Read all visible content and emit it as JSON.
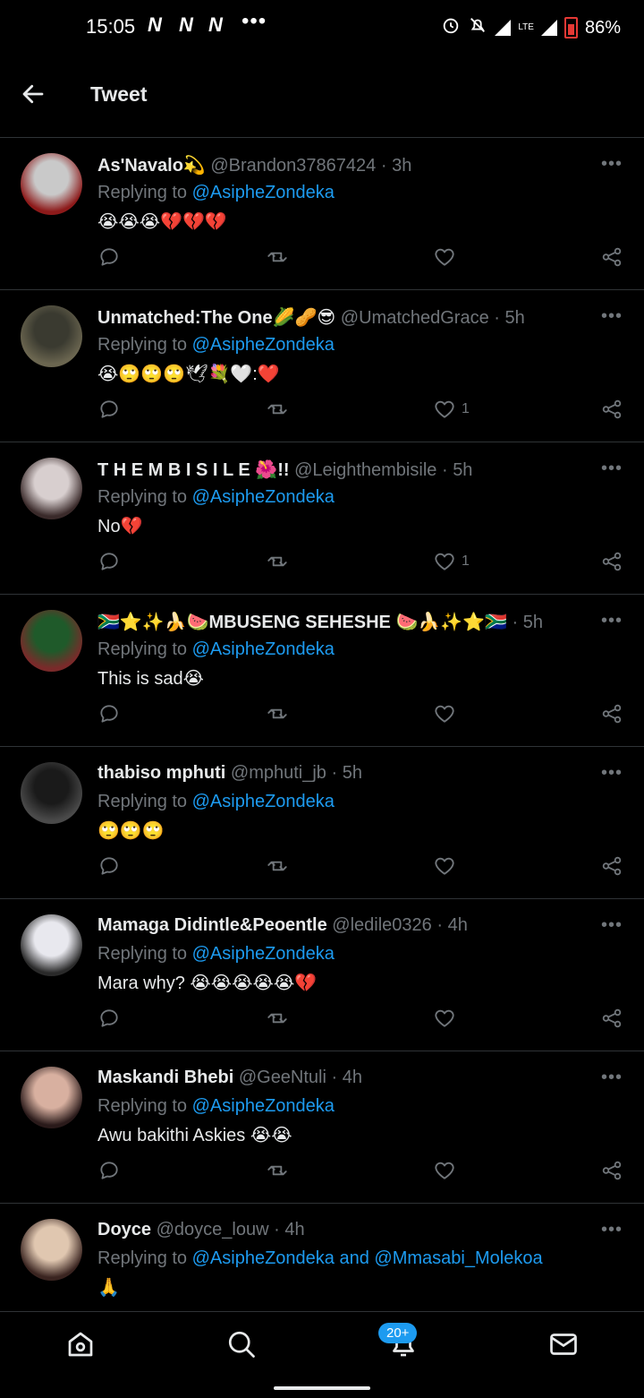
{
  "status_bar": {
    "time": "15:05",
    "carriers": [
      "N",
      "N",
      "N"
    ],
    "dots": "•••",
    "network": "LTE",
    "battery": "86%"
  },
  "header": {
    "title": "Tweet"
  },
  "colors": {
    "accent": "#1d9bf0",
    "muted": "#71767b",
    "text": "#e7e9ea",
    "divider": "#2f3336"
  },
  "tweets": [
    {
      "name": "As'Navalo💫",
      "handle": "@Brandon37867424",
      "time": "3h",
      "reply_prefix": "Replying to",
      "mention": "@AsipheZondeka",
      "mention2": "",
      "text": "😭😭😭💔💔💔",
      "likes": ""
    },
    {
      "name": "Unmatched:The One🌽🥜😎",
      "handle": "@UmatchedGrace",
      "time": "5h",
      "reply_prefix": "Replying to",
      "mention": "@AsipheZondeka",
      "mention2": "",
      "text": "😭🙄🙄🙄🕊💐🤍:❤️",
      "likes": "1"
    },
    {
      "name": "T H E M B I S I L E 🌺!!",
      "handle": "@Leighthembisile",
      "time": "5h",
      "reply_prefix": "Replying to",
      "mention": "@AsipheZondeka",
      "mention2": "",
      "text": "No💔",
      "likes": "1"
    },
    {
      "name": "🇿🇦⭐✨🍌🍉MBUSENG SEHESHE 🍉🍌✨⭐🇿🇦",
      "handle": "",
      "time": "5h",
      "reply_prefix": "Replying to",
      "mention": "@AsipheZondeka",
      "mention2": "",
      "text": "This is sad😭",
      "likes": ""
    },
    {
      "name": "thabiso mphuti",
      "handle": "@mphuti_jb",
      "time": "5h",
      "reply_prefix": "Replying to",
      "mention": "@AsipheZondeka",
      "mention2": "",
      "text": "🙄🙄🙄",
      "likes": ""
    },
    {
      "name": "Mamaga Didintle&Peoentle",
      "handle": "@ledile0326",
      "time": "4h",
      "reply_prefix": "Replying to",
      "mention": "@AsipheZondeka",
      "mention2": "",
      "text": "Mara why? 😭😭😭😭😭💔",
      "likes": ""
    },
    {
      "name": "Maskandi Bhebi",
      "handle": "@GeeNtuli",
      "time": "4h",
      "reply_prefix": "Replying to",
      "mention": "@AsipheZondeka",
      "mention2": "",
      "text": "Awu bakithi Askies 😭😭",
      "likes": ""
    },
    {
      "name": "Doyce",
      "handle": "@doyce_louw",
      "time": "4h",
      "reply_prefix": "Replying to",
      "mention": "@AsipheZondeka",
      "mention_join": "and",
      "mention2": "@Mmasabi_Molekoa",
      "text": "🙏",
      "likes": ""
    }
  ],
  "bottom_nav": {
    "notifications_badge": "20+"
  }
}
